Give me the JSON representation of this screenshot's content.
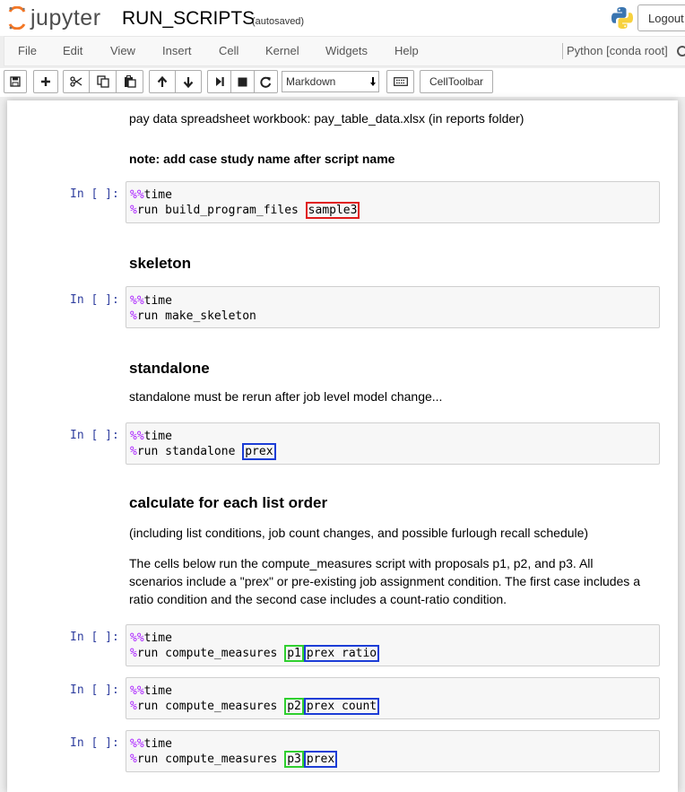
{
  "header": {
    "logo_text": "jupyter",
    "notebook_name": "RUN_SCRIPTS",
    "autosave_status": "(autosaved)",
    "logout_label": "Logout"
  },
  "menubar": {
    "items": [
      "File",
      "Edit",
      "View",
      "Insert",
      "Cell",
      "Kernel",
      "Widgets",
      "Help"
    ],
    "kernel_name": "Python [conda root]"
  },
  "toolbar": {
    "cell_type": "Markdown",
    "celltoolbar_label": "CellToolbar",
    "icons": [
      "save-icon",
      "plus-icon",
      "scissors-icon",
      "copy-icon",
      "paste-icon",
      "arrow-up-icon",
      "arrow-down-icon",
      "step-forward-icon",
      "stop-icon",
      "restart-icon",
      "keyboard-icon"
    ]
  },
  "cells": {
    "md_paydata": "pay data spreadsheet workbook: pay_table_data.xlsx (in reports folder)",
    "md_note": "note: add case study name after script name",
    "prompt": "In [ ]:",
    "magic_prefix": "%%",
    "time_word": "time",
    "run_prefix": "%",
    "c1_cmd": "run build_program_files ",
    "c1_arg": "sample3",
    "h_skeleton": "skeleton",
    "c2_cmd": "run make_skeleton",
    "h_standalone": "standalone",
    "md_standalone": "standalone must be rerun after job level model change...",
    "c3_cmd": "run standalone ",
    "c3_arg": "prex",
    "h_calculate": "calculate for each list order",
    "md_including": "(including list conditions, job count changes, and possible furlough recall schedule)",
    "md_cells_line1": "The cells below run the compute_measures script with proposals p1, p2, and p3. All",
    "md_cells_line2": "scenarios include a \"prex\" or pre-existing job assignment condition. The first case includes a",
    "md_cells_line3": "ratio condition and the second case includes a count-ratio condition.",
    "c4_cmd": "run compute_measures ",
    "c4_p": "p1",
    "c4_arg": "prex ratio",
    "c5_cmd": "run compute_measures ",
    "c5_p": "p2",
    "c5_arg": "prex count",
    "c6_cmd": "run compute_measures ",
    "c6_p": "p3",
    "c6_arg": "prex"
  },
  "colors": {
    "highlight_red": "#e01c1c",
    "highlight_blue": "#1c3dd6",
    "highlight_green": "#2fcf2f",
    "magic": "#aa22ff",
    "prompt": "#303f9f"
  }
}
